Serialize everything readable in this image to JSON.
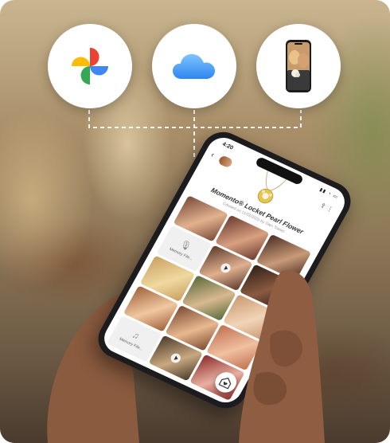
{
  "services": [
    {
      "name": "google-photos"
    },
    {
      "name": "icloud"
    },
    {
      "name": "phone-gallery"
    }
  ],
  "phone": {
    "status_time": "4:20",
    "title": "Momento® Locket Pearl Flower",
    "subtitle": "Created on 11/02/2025 by Glen Toews",
    "tiles": [
      {
        "type": "photo",
        "c1": "#7a4a3a",
        "c2": "#e2b28f"
      },
      {
        "type": "photo",
        "c1": "#6b3a2f",
        "c2": "#d9a080"
      },
      {
        "type": "photo",
        "c1": "#4a2e26",
        "c2": "#c89a76"
      },
      {
        "type": "audio",
        "label": "Memory File..."
      },
      {
        "type": "video",
        "c1": "#5a3a2a",
        "c2": "#e0b090"
      },
      {
        "type": "photo",
        "c1": "#2e2018",
        "c2": "#8a5a40"
      },
      {
        "type": "photo",
        "c1": "#c8a060",
        "c2": "#f0d8a0"
      },
      {
        "type": "photo",
        "c1": "#5a6a3a",
        "c2": "#d8b890"
      },
      {
        "type": "photo",
        "c1": "#c89870",
        "c2": "#f2d4b8"
      },
      {
        "type": "photo",
        "c1": "#a0603a",
        "c2": "#f0c8a0"
      },
      {
        "type": "photo",
        "c1": "#7a4a30",
        "c2": "#e8b890"
      },
      {
        "type": "photo",
        "c1": "#c07050",
        "c2": "#f0c0a0"
      },
      {
        "type": "audio",
        "label": "Memory File..."
      },
      {
        "type": "video",
        "c1": "#4a3a2a",
        "c2": "#c8a880"
      },
      {
        "type": "photo",
        "c1": "#8a2a2a",
        "c2": "#e8b0a0"
      }
    ]
  }
}
